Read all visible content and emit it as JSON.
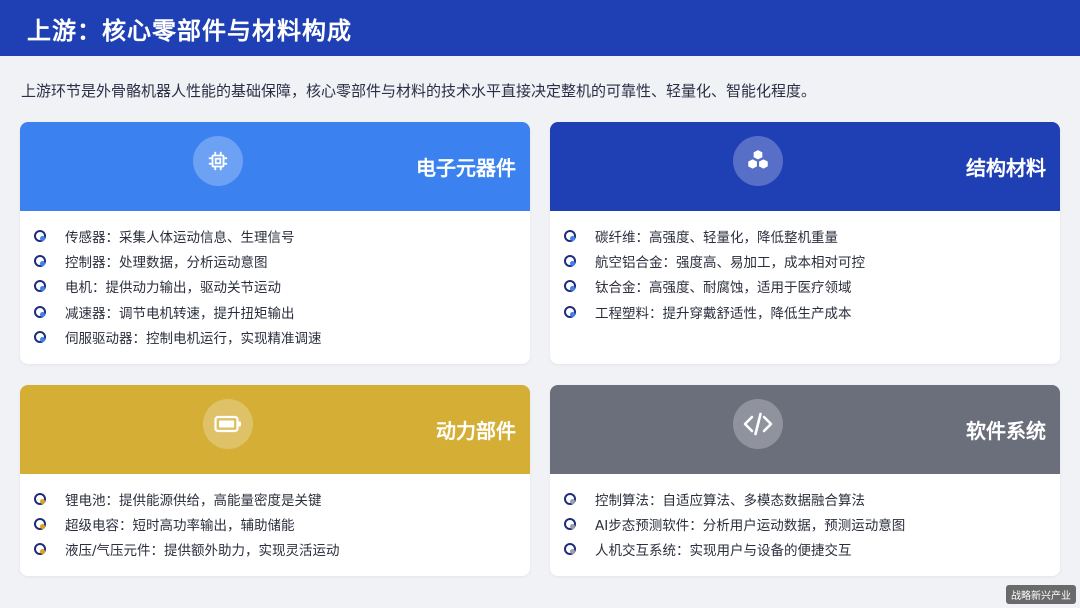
{
  "header": {
    "title": "上游：核心零部件与材料构成"
  },
  "intro": "上游环节是外骨骼机器人性能的基础保障，核心零部件与材料的技术水平直接决定整机的可靠性、轻量化、智能化程度。",
  "cards": [
    {
      "title": "电子元器件",
      "icon": "chip-icon",
      "color": "#3b82f0",
      "accent": "#3b82f0",
      "items": [
        "传感器：采集人体运动信息、生理信号",
        "控制器：处理数据，分析运动意图",
        "电机：提供动力输出，驱动关节运动",
        "减速器：调节电机转速，提升扭矩输出",
        "伺服驱动器：控制电机运行，实现精准调速"
      ]
    },
    {
      "title": "结构材料",
      "icon": "cubes-icon",
      "color": "#1f3fb4",
      "accent": "#3b82f0",
      "items": [
        "碳纤维：高强度、轻量化，降低整机重量",
        "航空铝合金：强度高、易加工，成本相对可控",
        "钛合金：高强度、耐腐蚀，适用于医疗领域",
        "工程塑料：提升穿戴舒适性，降低生产成本"
      ]
    },
    {
      "title": "动力部件",
      "icon": "battery-icon",
      "color": "#d4ae35",
      "accent": "#e0a21a",
      "items": [
        "锂电池：提供能源供给，高能量密度是关键",
        "超级电容：短时高功率输出，辅助储能",
        "液压/气压元件：提供额外助力，实现灵活运动"
      ]
    },
    {
      "title": "软件系统",
      "icon": "code-icon",
      "color": "#6b6f7c",
      "accent": "#9a9ea8",
      "items": [
        "控制算法：自适应算法、多模态数据融合算法",
        "AI步态预测软件：分析用户运动数据，预测运动意图",
        "人机交互系统：实现用户与设备的便捷交互"
      ]
    }
  ],
  "watermark": "战略新兴产业"
}
